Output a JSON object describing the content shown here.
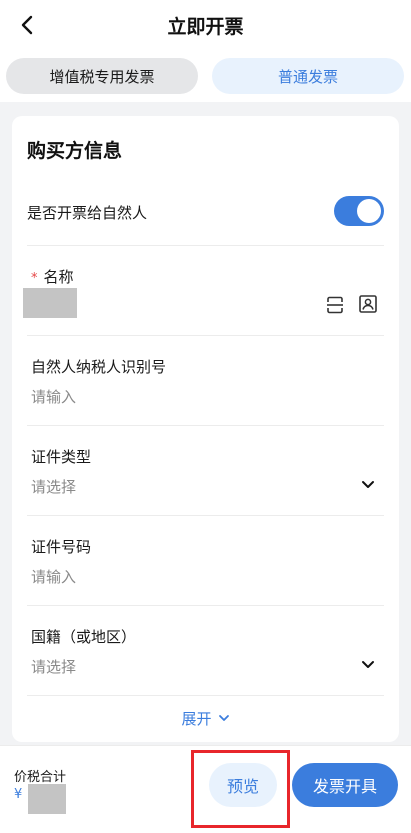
{
  "header": {
    "title": "立即开票"
  },
  "tabs": [
    {
      "label": "增值税专用发票",
      "active": false
    },
    {
      "label": "普通发票",
      "active": true
    }
  ],
  "buyer": {
    "section_title": "购买方信息",
    "toggle": {
      "label": "是否开票给自然人",
      "on": true
    },
    "fields": {
      "name": {
        "required_mark": "*",
        "label": "名称",
        "value": ""
      },
      "taxpayer_id": {
        "label": "自然人纳税人识别号",
        "placeholder": "请输入"
      },
      "id_type": {
        "label": "证件类型",
        "placeholder": "请选择"
      },
      "id_number": {
        "label": "证件号码",
        "placeholder": "请输入"
      },
      "nationality": {
        "label": "国籍（或地区）",
        "placeholder": "请选择"
      }
    },
    "expand_label": "展开"
  },
  "footer": {
    "total_label": "价税合计",
    "currency": "¥",
    "preview_label": "预览",
    "issue_label": "发票开具"
  },
  "colors": {
    "accent": "#3b7ddd",
    "highlight": "#e8262b",
    "required": "#e54545"
  }
}
